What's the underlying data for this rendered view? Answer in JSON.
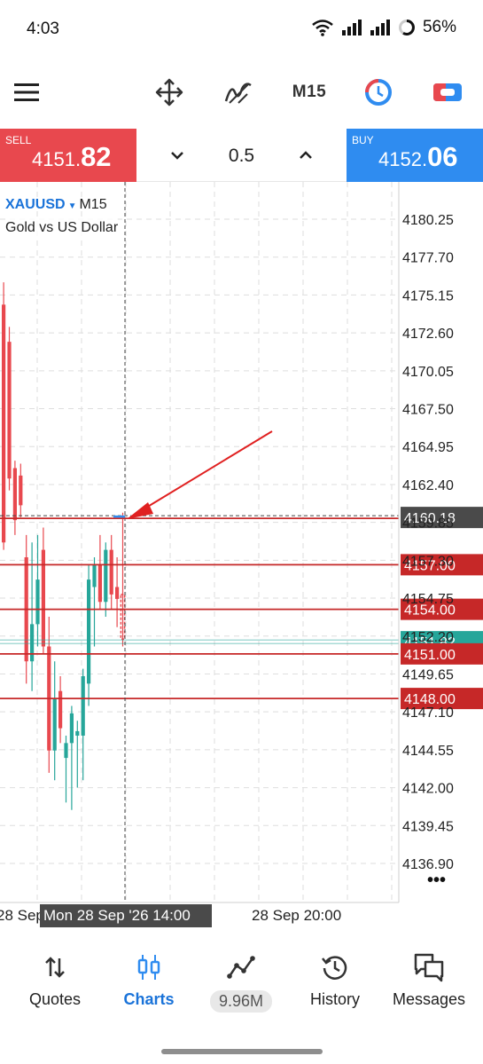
{
  "status_bar": {
    "time": "4:03",
    "battery": "56%"
  },
  "toolbar": {
    "timeframe": "M15"
  },
  "trade": {
    "sell_label": "SELL",
    "sell_price_small": "4151.",
    "sell_price_big": "82",
    "volume": "0.5",
    "buy_label": "BUY",
    "buy_price_small": "4152.",
    "buy_price_big": "06"
  },
  "chart": {
    "symbol": "XAUUSD",
    "timeframe": "M15",
    "description": "Gold vs US Dollar",
    "price_axis": [
      "4180.25",
      "4177.70",
      "4175.15",
      "4172.60",
      "4170.05",
      "4167.50",
      "4164.95",
      "4162.40",
      "4159.85",
      "4157.30",
      "4154.75",
      "4152.20",
      "4149.65",
      "4147.10",
      "4144.55",
      "4142.00",
      "4139.45",
      "4136.90"
    ],
    "price_axis_range": [
      4136.9,
      4180.25
    ],
    "crosshair_price": "4160.18",
    "levels": [
      "4157.00",
      "4154.00",
      "4151.00",
      "4148.00"
    ],
    "bid_price_tag": "4151.82",
    "time_axis": {
      "left_clipped": "28 Sep",
      "crosshair_time": "Mon 28 Sep '26 14:00",
      "right_label": "28 Sep 20:00"
    },
    "more_label": "•••",
    "colors": {
      "bear": "#e8484e",
      "bull": "#26a69a",
      "level": "#c62828",
      "bid": "#26a69a",
      "crosshair": "#444444"
    }
  },
  "chart_data": {
    "type": "candlestick",
    "symbol": "XAUUSD",
    "timeframe": "M15",
    "ylim": [
      4136.9,
      4180.25
    ],
    "candles": [
      {
        "o": 4174.5,
        "h": 4176.0,
        "l": 4158.0,
        "c": 4158.5,
        "dir": "bear"
      },
      {
        "o": 4172.0,
        "h": 4173.0,
        "l": 4162.0,
        "c": 4162.8,
        "dir": "bear"
      },
      {
        "o": 4163.5,
        "h": 4164.0,
        "l": 4159.0,
        "c": 4160.0,
        "dir": "bear"
      },
      {
        "o": 4163.0,
        "h": 4163.8,
        "l": 4160.2,
        "c": 4161.0,
        "dir": "bear"
      },
      {
        "o": 4157.5,
        "h": 4159.0,
        "l": 4149.0,
        "c": 4150.5,
        "dir": "bear"
      },
      {
        "o": 4150.5,
        "h": 4158.5,
        "l": 4148.5,
        "c": 4153.0,
        "dir": "bull"
      },
      {
        "o": 4153.0,
        "h": 4159.0,
        "l": 4151.5,
        "c": 4156.0,
        "dir": "bull"
      },
      {
        "o": 4158.0,
        "h": 4159.5,
        "l": 4151.0,
        "c": 4151.5,
        "dir": "bear"
      },
      {
        "o": 4151.5,
        "h": 4153.5,
        "l": 4143.0,
        "c": 4144.5,
        "dir": "bear"
      },
      {
        "o": 4144.5,
        "h": 4150.5,
        "l": 4142.5,
        "c": 4148.0,
        "dir": "bull"
      },
      {
        "o": 4148.5,
        "h": 4149.5,
        "l": 4145.0,
        "c": 4146.0,
        "dir": "bear"
      },
      {
        "o": 4144.0,
        "h": 4145.5,
        "l": 4141.0,
        "c": 4145.0,
        "dir": "bull"
      },
      {
        "o": 4145.0,
        "h": 4147.5,
        "l": 4140.5,
        "c": 4147.0,
        "dir": "bull"
      },
      {
        "o": 4145.5,
        "h": 4146.5,
        "l": 4142.0,
        "c": 4145.8,
        "dir": "bull"
      },
      {
        "o": 4145.5,
        "h": 4150.0,
        "l": 4142.5,
        "c": 4149.5,
        "dir": "bull"
      },
      {
        "o": 4149.0,
        "h": 4157.0,
        "l": 4147.5,
        "c": 4156.0,
        "dir": "bull"
      },
      {
        "o": 4155.5,
        "h": 4157.5,
        "l": 4151.5,
        "c": 4157.0,
        "dir": "bull"
      },
      {
        "o": 4157.0,
        "h": 4159.0,
        "l": 4154.0,
        "c": 4154.5,
        "dir": "bear"
      },
      {
        "o": 4154.5,
        "h": 4158.5,
        "l": 4153.5,
        "c": 4158.0,
        "dir": "bull"
      },
      {
        "o": 4158.0,
        "h": 4159.0,
        "l": 4154.0,
        "c": 4155.0,
        "dir": "bear"
      },
      {
        "o": 4155.5,
        "h": 4157.5,
        "l": 4152.8,
        "c": 4154.7,
        "dir": "bear"
      },
      {
        "o": 4155.0,
        "h": 4160.5,
        "l": 4151.5,
        "c": 4152.0,
        "dir": "bear"
      }
    ],
    "horizontal_levels": [
      4157.0,
      4154.0,
      4151.0,
      4148.0
    ],
    "bid": 4151.82,
    "crosshair": 4160.18
  },
  "nav": {
    "quotes": "Quotes",
    "charts": "Charts",
    "volume_badge": "9.96M",
    "history": "History",
    "messages": "Messages"
  }
}
